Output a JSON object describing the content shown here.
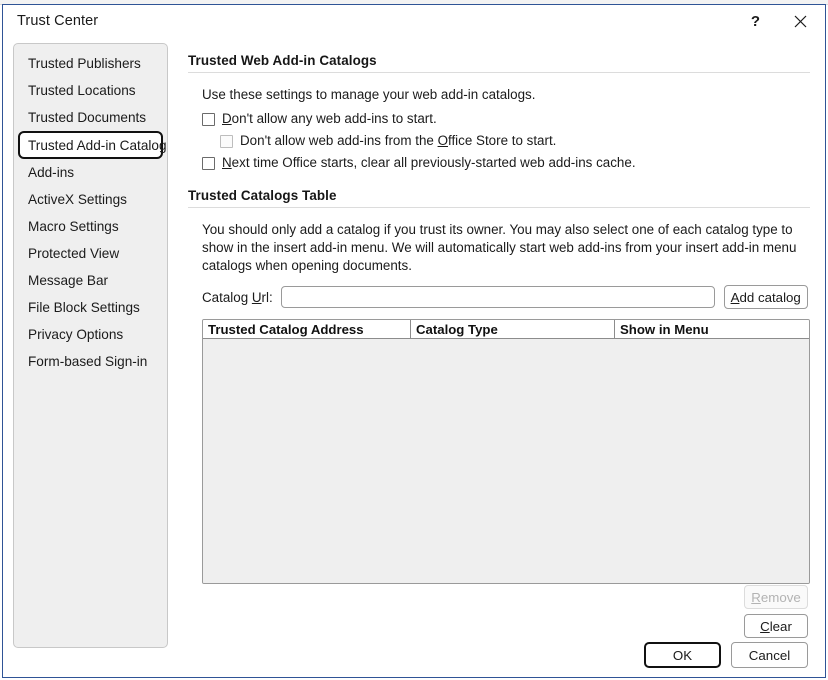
{
  "window": {
    "title": "Trust Center",
    "help_icon": "question-mark-icon",
    "close_icon": "close-icon",
    "border_color": "#2f5496"
  },
  "sidebar": {
    "items": [
      {
        "label": "Trusted Publishers",
        "selected": false
      },
      {
        "label": "Trusted Locations",
        "selected": false
      },
      {
        "label": "Trusted Documents",
        "selected": false
      },
      {
        "label": "Trusted Add-in Catalogs",
        "selected": true
      },
      {
        "label": "Add-ins",
        "selected": false
      },
      {
        "label": "ActiveX Settings",
        "selected": false
      },
      {
        "label": "Macro Settings",
        "selected": false
      },
      {
        "label": "Protected View",
        "selected": false
      },
      {
        "label": "Message Bar",
        "selected": false
      },
      {
        "label": "File Block Settings",
        "selected": false
      },
      {
        "label": "Privacy Options",
        "selected": false
      },
      {
        "label": "Form-based Sign-in",
        "selected": false
      }
    ]
  },
  "main": {
    "section1": {
      "heading": "Trusted Web Add-in Catalogs",
      "description": "Use these settings to manage your web add-in catalogs.",
      "checkboxes": [
        {
          "pre": "",
          "accel": "D",
          "post": "on't allow any web add-ins to start.",
          "checked": false,
          "disabled": false,
          "indented": false
        },
        {
          "pre": "Don't allow web add-ins from the ",
          "accel": "O",
          "post": "ffice Store to start.",
          "checked": false,
          "disabled": true,
          "indented": true
        },
        {
          "pre": "",
          "accel": "N",
          "post": "ext time Office starts, clear all previously-started web add-ins cache.",
          "checked": false,
          "disabled": false,
          "indented": false
        }
      ]
    },
    "section2": {
      "heading": "Trusted Catalogs Table",
      "description": "You should only add a catalog if you trust its owner. You may also select one of each catalog type to show in the insert add-in menu. We will automatically start web add-ins from your insert add-in menu catalogs when opening documents.",
      "url_label_pre": "Catalog ",
      "url_label_accel": "U",
      "url_label_post": "rl:",
      "url_value": "",
      "url_placeholder": "",
      "add_button_pre": "",
      "add_button_accel": "A",
      "add_button_post": "dd catalog",
      "table": {
        "columns": [
          "Trusted Catalog Address",
          "Catalog Type",
          "Show in Menu"
        ],
        "rows": []
      },
      "remove_button_pre": "",
      "remove_button_accel": "R",
      "remove_button_post": "emove",
      "remove_disabled": true,
      "clear_button_pre": "",
      "clear_button_accel": "C",
      "clear_button_post": "lear",
      "clear_disabled": false
    }
  },
  "footer": {
    "ok_label": "OK",
    "cancel_label": "Cancel",
    "default_button": "OK"
  }
}
